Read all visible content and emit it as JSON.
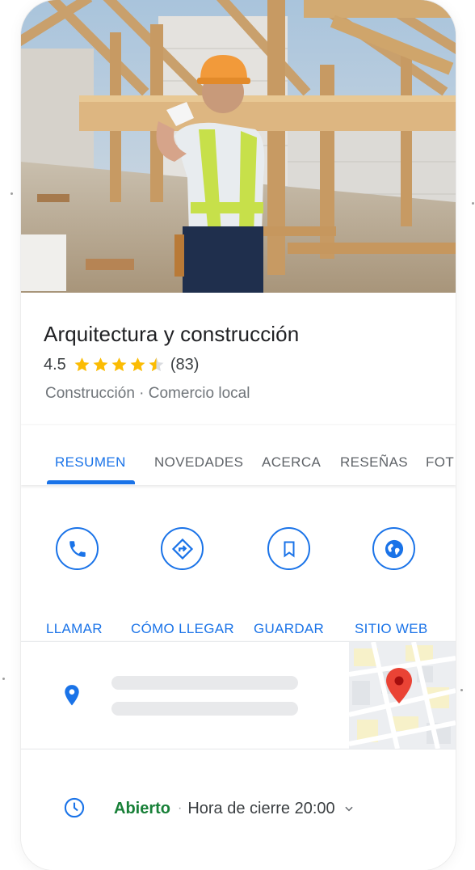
{
  "business": {
    "name": "Arquitectura y construcción",
    "rating": "4.5",
    "stars": 4.5,
    "review_count": "(83)",
    "category": "Construcción · Comercio local"
  },
  "tabs": [
    {
      "label": "RESUMEN",
      "active": true
    },
    {
      "label": "NOVEDADES",
      "active": false
    },
    {
      "label": "ACERCA",
      "active": false
    },
    {
      "label": "RESEÑAS",
      "active": false
    },
    {
      "label": "FOT",
      "active": false
    }
  ],
  "actions": [
    {
      "label": "LLAMAR",
      "icon": "phone-icon"
    },
    {
      "label": "CÓMO LLEGAR",
      "icon": "directions-icon"
    },
    {
      "label": "GUARDAR",
      "icon": "bookmark-icon"
    },
    {
      "label": "SITIO WEB",
      "icon": "globe-icon"
    }
  ],
  "hours": {
    "status": "Abierto",
    "separator": "·",
    "closing": "Hora de cierre 20:00"
  },
  "colors": {
    "accent": "#1a73e8",
    "open": "#188038",
    "star": "#fbbc04",
    "map_pin": "#ea4335"
  }
}
